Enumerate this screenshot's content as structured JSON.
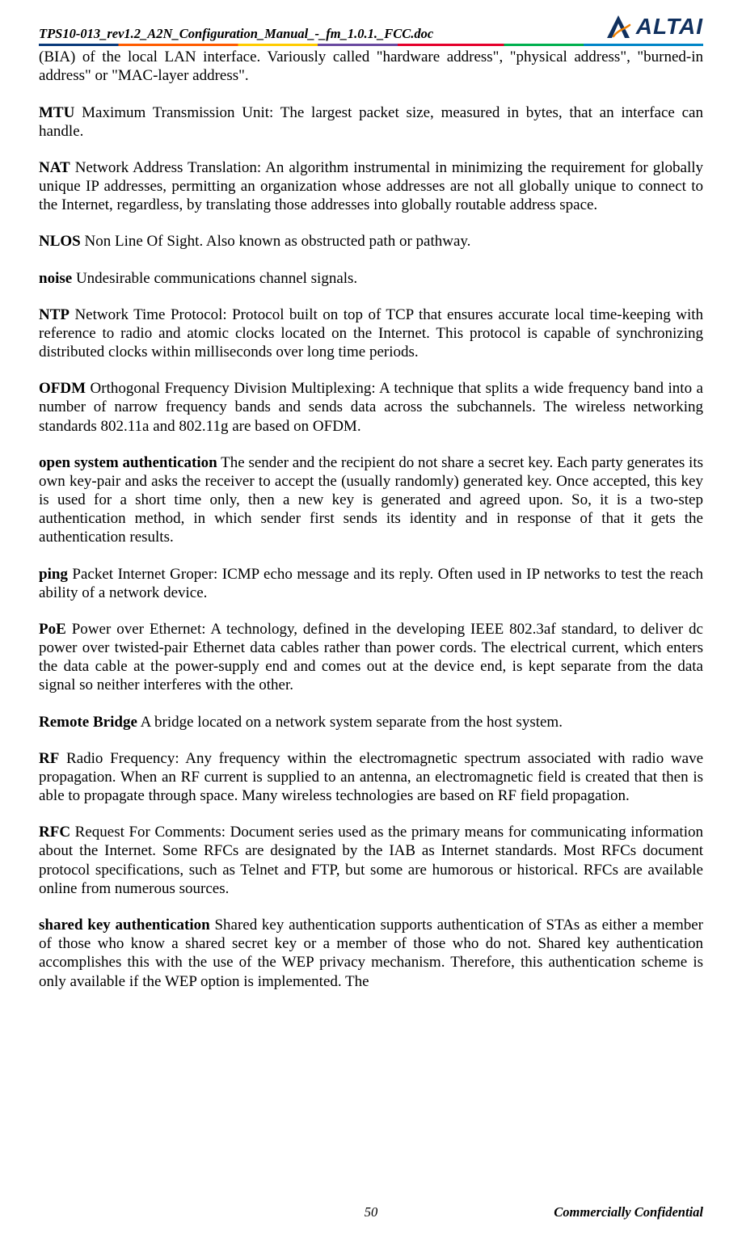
{
  "header": {
    "doc_name": "TPS10-013_rev1.2_A2N_Configuration_Manual_-_fm_1.0.1._FCC.doc",
    "logo_text": "ALTAI"
  },
  "entries": {
    "bia_cont": "(BIA) of the local LAN interface.    Variously called \"hardware address\", \"physical address\", \"burned-in address\" or \"MAC-layer address\".",
    "mtu_term": "MTU",
    "mtu_def": "   Maximum Transmission Unit: The largest packet size, measured in bytes, that an interface can handle.",
    "nat_term": "NAT",
    "nat_def": "    Network Address Translation: An algorithm instrumental in minimizing the requirement for globally unique IP addresses, permitting an organization whose addresses are not all globally unique to connect to the Internet, regardless, by translating those addresses into globally routable address space.",
    "nlos_term": "NLOS",
    "nlos_def": "    Non Line Of Sight.    Also known as obstructed path or pathway.",
    "noise_term": "noise",
    "noise_def": "    Undesirable communications channel signals.",
    "ntp_term": "NTP",
    "ntp_def": "   Network Time Protocol: Protocol built on top of TCP that ensures accurate local time-keeping with reference to radio and atomic clocks located on the Internet.    This protocol is capable of synchronizing distributed clocks within milliseconds over long time periods.",
    "ofdm_term": "OFDM",
    "ofdm_def": "   Orthogonal Frequency Division Multiplexing: A technique that splits a wide frequency band into a number of narrow frequency bands and sends data across the subchannels. The wireless networking standards 802.11a and 802.11g are based on OFDM.",
    "osa_term": "open system authentication",
    "osa_def": "   The sender and the recipient do not share a secret key.   Each party generates its own key-pair and asks the receiver to accept the (usually randomly) generated key.   Once accepted, this key is used for a short time only, then a new key is generated and agreed upon.    So, it is a two-step authentication method, in which sender first sends its identity and in response of that it gets the authentication results.",
    "ping_term": "ping",
    "ping_def": "    Packet Internet Groper: ICMP echo message and its reply.    Often used in IP networks to test the reach ability of a network device.",
    "poe_term": "PoE",
    "poe_def": "    Power over Ethernet: A technology, defined in the developing IEEE 802.3af standard, to deliver dc power over twisted-pair Ethernet data cables rather than power cords.    The electrical current, which enters the data cable at the power-supply end and comes out at the device end, is kept separate from the data signal so neither interferes with the other.",
    "rb_term": "Remote Bridge",
    "rb_def": "    A bridge located on a network system separate from the host system.",
    "rf_term": "RF",
    "rf_def": "   Radio Frequency: Any frequency within the electromagnetic spectrum associated with radio wave propagation.   When an RF current is supplied to an antenna, an electromagnetic field is created that then is able to propagate through space.   Many wireless technologies are based on RF field propagation.",
    "rfc_term": "RFC",
    "rfc_def": "    Request For Comments: Document series used as the primary means for communicating information about the Internet.   Some RFCs are designated by the IAB as Internet standards.   Most RFCs document protocol specifications, such as Telnet and FTP, but some are humorous or historical.    RFCs are available online from numerous sources.",
    "ska_term": "shared key authentication",
    "ska_def": "   Shared key authentication supports authentication of STAs as either a member of those who know a shared secret key or a member of those who do not.   Shared key authentication accomplishes this with the use of the WEP privacy mechanism.   Therefore, this authentication scheme is only available if the WEP option is implemented.    The"
  },
  "footer": {
    "page": "50",
    "confidential": "Commercially Confidential"
  }
}
